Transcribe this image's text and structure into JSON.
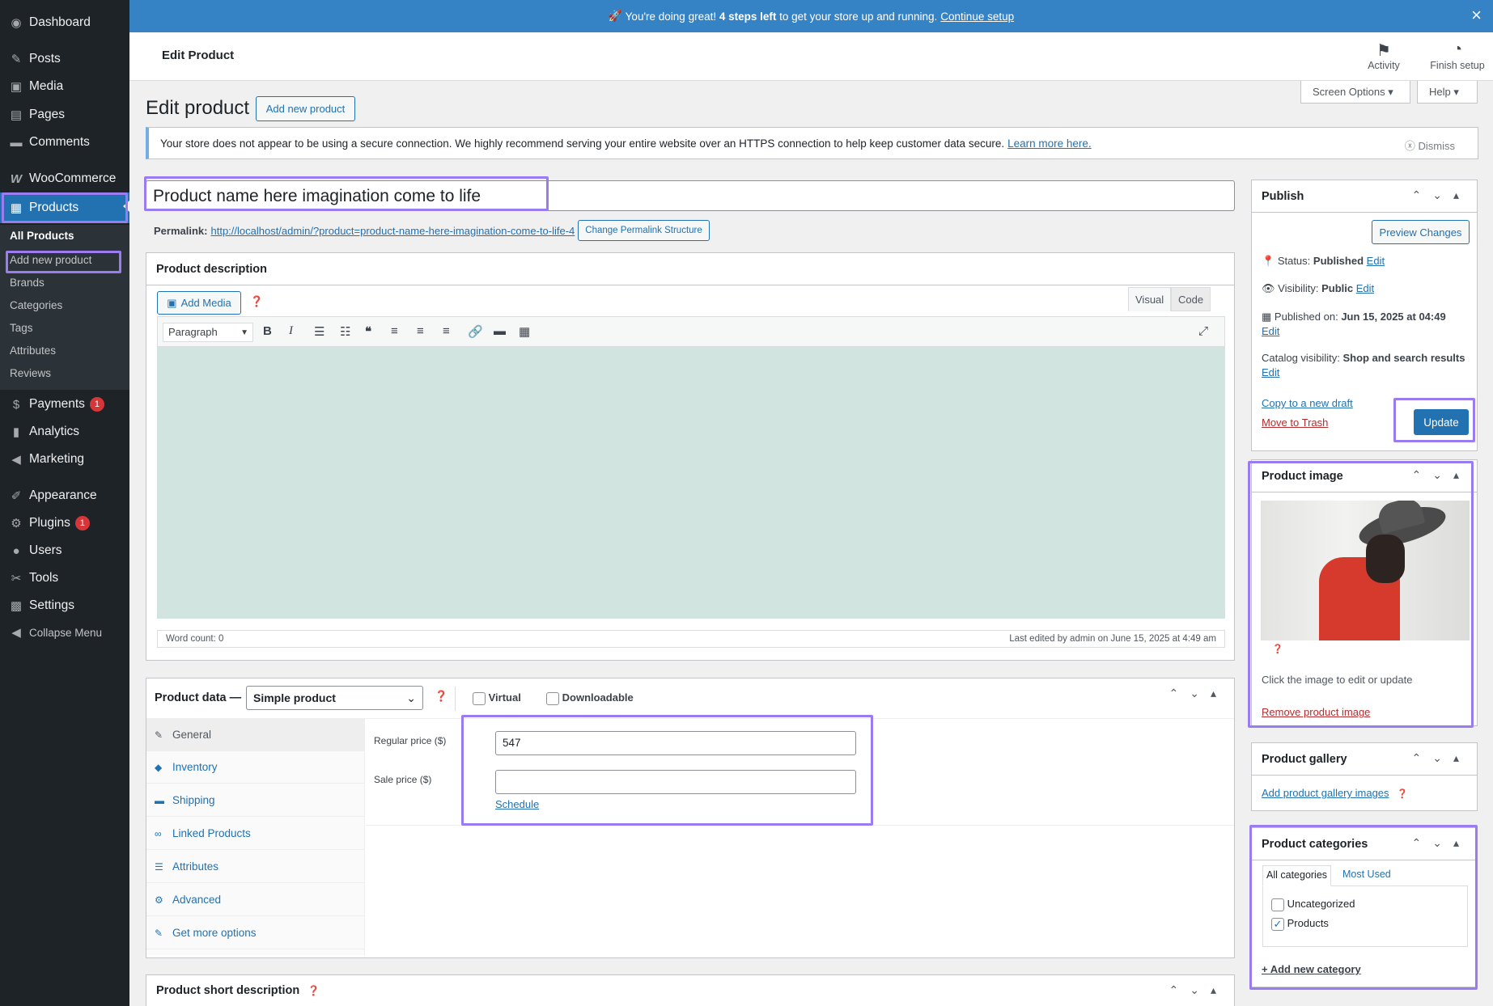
{
  "banner": {
    "emoji": "🚀",
    "text_pre": "You're doing great!",
    "steps": "4 steps left",
    "text_post": "to get your store up and running.",
    "link": "Continue setup",
    "close": "×"
  },
  "header": {
    "title": "Edit Product",
    "activity": "Activity",
    "finish_setup": "Finish setup"
  },
  "screen_options": {
    "label": "Screen Options ▾",
    "help": "Help ▾"
  },
  "sidebar": {
    "items": [
      {
        "label": "Dashboard",
        "icon": "dashboard-icon",
        "glyph": "◉"
      },
      {
        "label": "Posts",
        "icon": "pin-icon",
        "glyph": "✎"
      },
      {
        "label": "Media",
        "icon": "media-icon",
        "glyph": "▣"
      },
      {
        "label": "Pages",
        "icon": "pages-icon",
        "glyph": "▤"
      },
      {
        "label": "Comments",
        "icon": "comment-icon",
        "glyph": "▬"
      },
      {
        "label": "WooCommerce",
        "icon": "woo-icon",
        "glyph": "W"
      },
      {
        "label": "Products",
        "icon": "box-icon",
        "glyph": "▦"
      },
      {
        "label": "Payments",
        "icon": "dollar-icon",
        "glyph": "$",
        "badge": "1"
      },
      {
        "label": "Analytics",
        "icon": "bar-chart-icon",
        "glyph": "▮"
      },
      {
        "label": "Marketing",
        "icon": "megaphone-icon",
        "glyph": "◀"
      },
      {
        "label": "Appearance",
        "icon": "brush-icon",
        "glyph": "✐"
      },
      {
        "label": "Plugins",
        "icon": "plug-icon",
        "glyph": "⚙",
        "badge": "1"
      },
      {
        "label": "Users",
        "icon": "user-icon",
        "glyph": "●"
      },
      {
        "label": "Tools",
        "icon": "wrench-icon",
        "glyph": "✂"
      },
      {
        "label": "Settings",
        "icon": "settings-icon",
        "glyph": "▩"
      },
      {
        "label": "Collapse Menu",
        "icon": "collapse-icon",
        "glyph": "◀"
      }
    ],
    "submenu": [
      "All Products",
      "Add new product",
      "Brands",
      "Categories",
      "Tags",
      "Attributes",
      "Reviews"
    ]
  },
  "page": {
    "title": "Edit product",
    "add_new": "Add new product"
  },
  "notice": {
    "text": "Your store does not appear to be using a secure connection. We highly recommend serving your entire website over an HTTPS connection to help keep customer data secure.",
    "link": "Learn more here.",
    "dismiss": "Dismiss"
  },
  "product": {
    "title": "Product name here imagination come to life",
    "permalink_label": "Permalink:",
    "permalink_url": "http://localhost/admin/?product=product-name-here-imagination-come-to-life-4",
    "permalink_button": "Change Permalink Structure"
  },
  "description": {
    "heading": "Product description",
    "add_media": "Add Media",
    "tab_visual": "Visual",
    "tab_code": "Code",
    "format": "Paragraph",
    "word_count": "Word count: 0",
    "last_edited": "Last edited by admin on June 15, 2025 at 4:49 am"
  },
  "product_data": {
    "label": "Product data —",
    "type": "Simple product",
    "virtual": "Virtual",
    "downloadable": "Downloadable",
    "tabs": [
      "General",
      "Inventory",
      "Shipping",
      "Linked Products",
      "Attributes",
      "Advanced",
      "Get more options"
    ],
    "regular_price_label": "Regular price ($)",
    "regular_price": "547",
    "sale_price_label": "Sale price ($)",
    "sale_price": "",
    "schedule": "Schedule"
  },
  "short_description": {
    "heading": "Product short description"
  },
  "publish": {
    "heading": "Publish",
    "preview": "Preview Changes",
    "status_label": "Status:",
    "status": "Published",
    "visibility_label": "Visibility:",
    "visibility": "Public",
    "published_on_label": "Published on:",
    "published_on": "Jun 15, 2025 at 04:49",
    "catalog_label": "Catalog visibility:",
    "catalog": "Shop and search results",
    "edit": "Edit",
    "copy_draft": "Copy to a new draft",
    "trash": "Move to Trash",
    "update": "Update"
  },
  "product_image": {
    "heading": "Product image",
    "hint": "Click the image to edit or update",
    "remove": "Remove product image"
  },
  "gallery": {
    "heading": "Product gallery",
    "add": "Add product gallery images"
  },
  "categories": {
    "heading": "Product categories",
    "tab_all": "All categories",
    "tab_used": "Most Used",
    "items": [
      {
        "label": "Uncategorized",
        "checked": false
      },
      {
        "label": "Products",
        "checked": true
      }
    ],
    "add": "+ Add new category"
  },
  "colors": {
    "admin_dark": "#1d2327",
    "accent": "#2271b1",
    "banner": "#3582c4",
    "highlight": "#9b7cf0",
    "editor_bg": "#d2e4df"
  }
}
